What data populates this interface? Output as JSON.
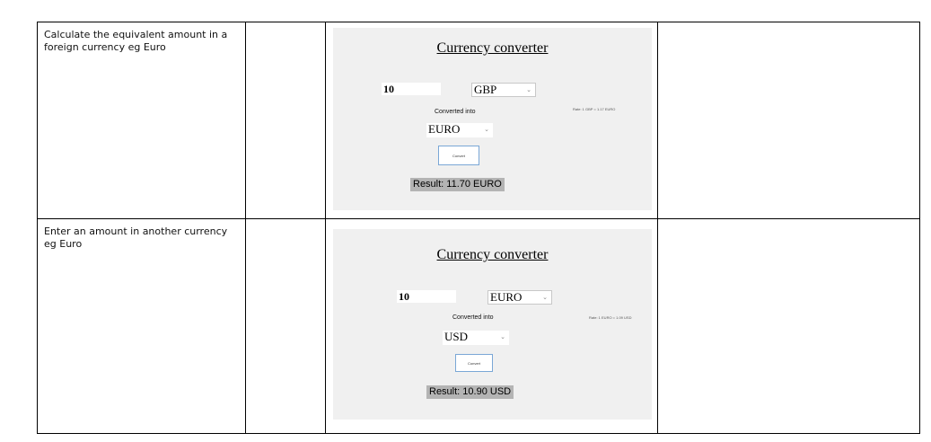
{
  "rows": [
    {
      "description": "Calculate the equivalent amount in a foreign currency eg Euro",
      "app": {
        "title": "Currency converter",
        "amount": "10",
        "from_currency": "GBP",
        "converted_label": "Converted into",
        "rate_text": "Rate: 1 GBP = 1.17 EURO",
        "to_currency": "EURO",
        "button_label": "Convert",
        "result": "Result: 11.70 EURO"
      }
    },
    {
      "description": "Enter an amount in another currency eg Euro",
      "app": {
        "title": "Currency converter",
        "amount": "10",
        "from_currency": "EURO",
        "converted_label": "Converted into",
        "rate_text": "Rate: 1 EURO = 1.09 USD",
        "to_currency": "USD",
        "button_label": "Convert",
        "result": "Result: 10.90 USD"
      }
    }
  ]
}
